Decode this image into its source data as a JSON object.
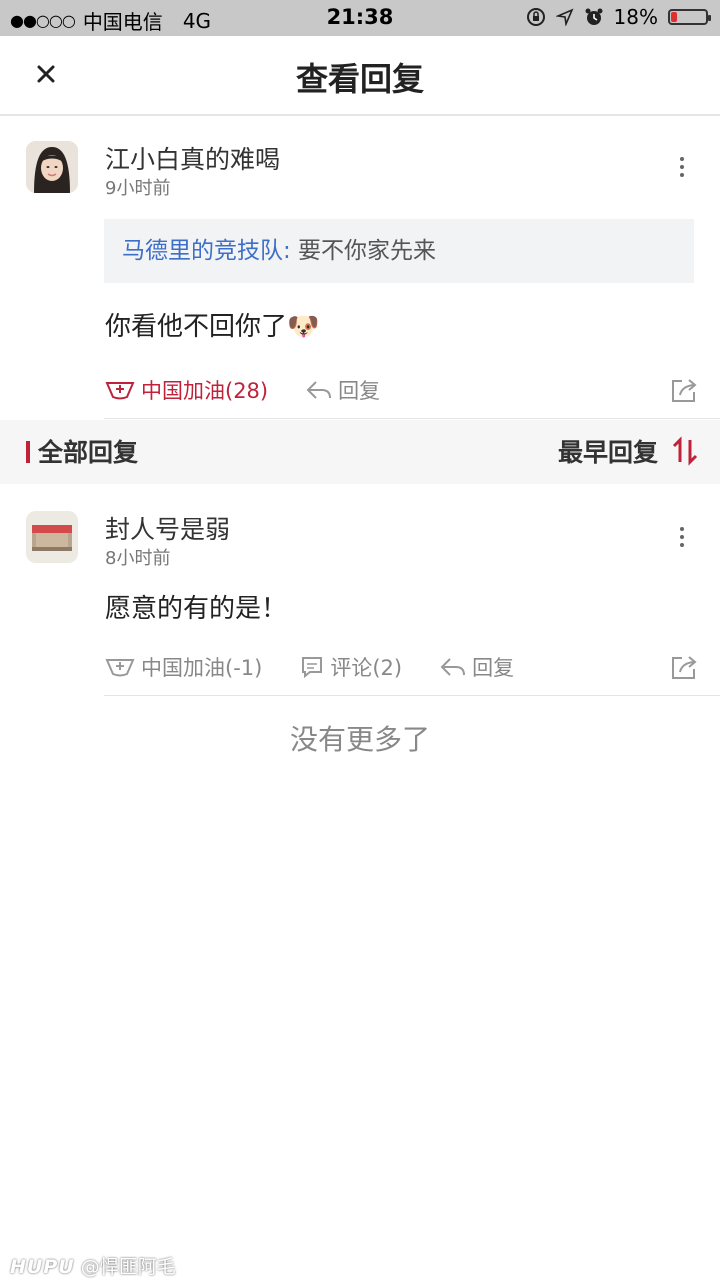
{
  "status_bar": {
    "signal": "●●○○○",
    "carrier": "中国电信",
    "network": "4G",
    "time": "21:38",
    "battery": "18%",
    "battery_level": 0.18
  },
  "header": {
    "title": "查看回复"
  },
  "main_post": {
    "username": "江小白真的难喝",
    "time": "9小时前",
    "quote_user": "马德里的竞技队:",
    "quote_text": " 要不你家先来",
    "content": "你看他不回你了🐶",
    "like_label": "中国加油(28)",
    "reply_label": "回复"
  },
  "section": {
    "label": "全部回复",
    "sort_label": "最早回复"
  },
  "replies": [
    {
      "username": "封人号是弱",
      "time": "8小时前",
      "content": "愿意的有的是！",
      "like_label": "中国加油(-1)",
      "comment_label": "评论(2)",
      "reply_label": "回复"
    }
  ],
  "footer": {
    "no_more": "没有更多了"
  },
  "watermark": {
    "logo": "HUPU",
    "handle": "@悍匪阿毛"
  },
  "colors": {
    "accent_red": "#c0223a",
    "link_blue": "#3d6fc8"
  }
}
